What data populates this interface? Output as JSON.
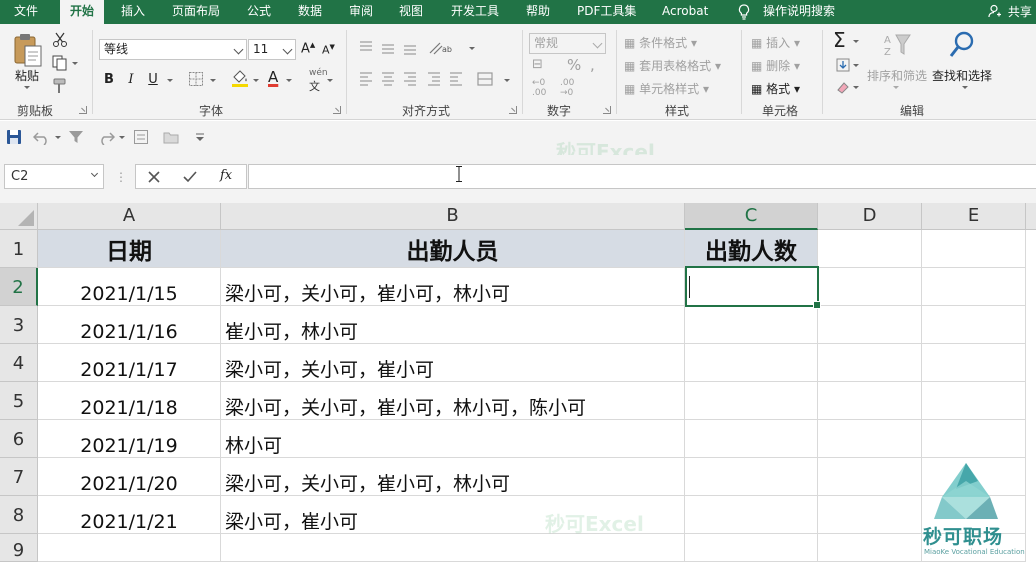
{
  "tabs": [
    {
      "label": "文件"
    },
    {
      "label": "开始"
    },
    {
      "label": "插入"
    },
    {
      "label": "页面布局"
    },
    {
      "label": "公式"
    },
    {
      "label": "数据"
    },
    {
      "label": "审阅"
    },
    {
      "label": "视图"
    },
    {
      "label": "开发工具"
    },
    {
      "label": "帮助"
    },
    {
      "label": "PDF工具集"
    },
    {
      "label": "Acrobat"
    }
  ],
  "tell_me": "操作说明搜索",
  "share": "共享",
  "ribbon": {
    "clipboard": {
      "paste": "粘贴",
      "label": "剪贴板"
    },
    "font": {
      "name": "等线",
      "size": "11",
      "bold": "B",
      "italic": "I",
      "underline": "U",
      "label": "字体"
    },
    "alignment": {
      "label": "对齐方式"
    },
    "number": {
      "format": "常规",
      "label": "数字"
    },
    "styles": {
      "conditional": "条件格式",
      "table": "套用表格格式",
      "cell_styles": "单元格样式",
      "label": "样式"
    },
    "cells": {
      "insert": "插入",
      "delete": "删除",
      "format": "格式",
      "label": "单元格"
    },
    "editing": {
      "sort_filter": "排序和筛选",
      "find_select": "查找和选择",
      "label": "编辑"
    }
  },
  "formula_bar": {
    "name_box": "C2",
    "value": ""
  },
  "columns": [
    "A",
    "B",
    "C",
    "D",
    "E"
  ],
  "rows": [
    "1",
    "2",
    "3",
    "4",
    "5",
    "6",
    "7",
    "8",
    "9"
  ],
  "table": {
    "headers": [
      "日期",
      "出勤人员",
      "出勤人数"
    ],
    "rows": [
      {
        "date": "2021/1/15",
        "people": "梁小可，关小可，崔小可，林小可"
      },
      {
        "date": "2021/1/16",
        "people": "崔小可，林小可"
      },
      {
        "date": "2021/1/17",
        "people": "梁小可，关小可，崔小可"
      },
      {
        "date": "2021/1/18",
        "people": "梁小可，关小可，崔小可，林小可，陈小可"
      },
      {
        "date": "2021/1/19",
        "people": "林小可"
      },
      {
        "date": "2021/1/20",
        "people": "梁小可，关小可，崔小可，林小可"
      },
      {
        "date": "2021/1/21",
        "people": "梁小可，崔小可"
      }
    ]
  },
  "watermark": "秒可Excel",
  "logo": {
    "name": "秒可职场",
    "sub": "MiaoKe Vocational Education"
  },
  "colors": {
    "accent": "#217346",
    "header_fill": "#d6dce4",
    "font_color_bar": "#e03c31",
    "fill_color_bar": "#f5d800"
  }
}
